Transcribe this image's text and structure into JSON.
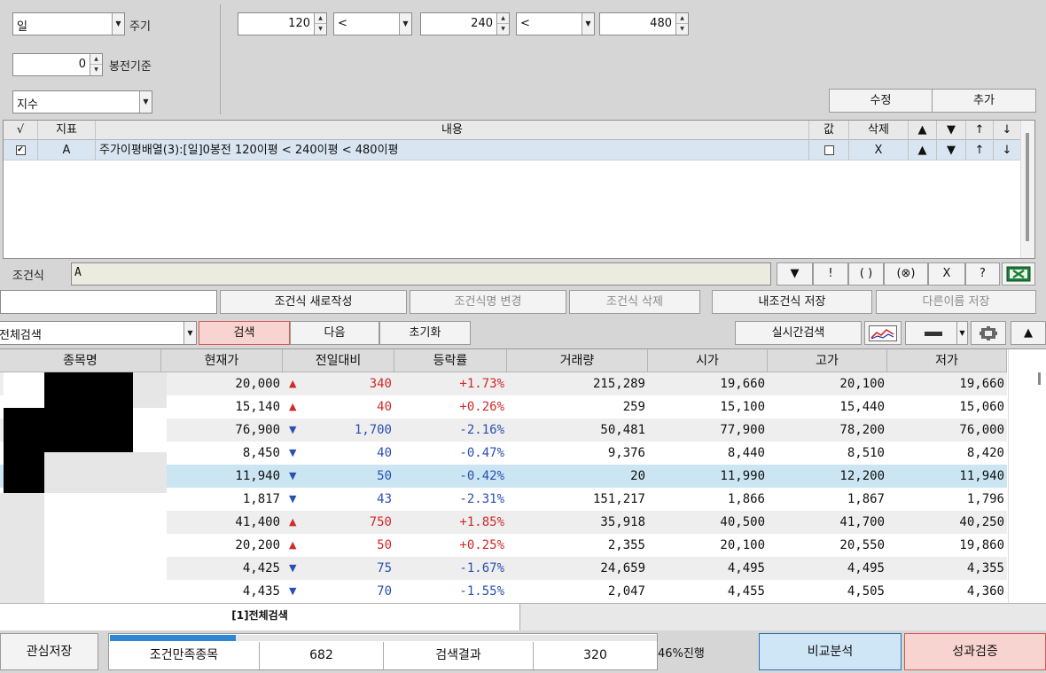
{
  "controls": {
    "period_value": "일",
    "period_label": "주기",
    "bar_value": "0",
    "bar_label": "봉전기준",
    "type_value": "지수",
    "ma1": "120",
    "op1": "<",
    "ma2": "240",
    "op2": "<",
    "ma3": "480",
    "modify_label": "수정",
    "add_label": "추가"
  },
  "condition_table": {
    "headers": [
      "√",
      "지표",
      "내용",
      "값",
      "삭제",
      "▲",
      "▼",
      "↑",
      "↓"
    ],
    "rows": [
      {
        "check": "✔",
        "indicator": "A",
        "content": "주가이평배열(3):[일]0봉전 120이평 < 240이평 < 480이평",
        "value": "",
        "delete": "X",
        "up": "▲",
        "down": "▼",
        "top": "↑",
        "bottom": "↓"
      }
    ]
  },
  "formula": {
    "label": "조건식",
    "value": "A",
    "ops": [
      "▼",
      "!",
      "( )",
      "(⊗)",
      "X",
      "?"
    ]
  },
  "actions": {
    "new": "조건식 새로작성",
    "rename": "조건식명 변경",
    "delete": "조건식 삭제",
    "save": "내조건식 저장",
    "save_as": "다른이름 저장"
  },
  "search": {
    "scope": "전체검색",
    "search": "검색",
    "next": "다음",
    "reset": "초기화",
    "realtime": "실시간검색",
    "up": "▲"
  },
  "grid": {
    "headers": [
      "종목명",
      "현재가",
      "전일대비",
      "등락률",
      "거래량",
      "시가",
      "고가",
      "저가"
    ],
    "rows": [
      {
        "price": "20,000",
        "dir": "up",
        "arrow": "▲",
        "change": "340",
        "rate": "+1.73%",
        "volume": "215,289",
        "open": "19,660",
        "high": "20,100",
        "low": "19,660"
      },
      {
        "price": "15,140",
        "dir": "up",
        "arrow": "▲",
        "change": "40",
        "rate": "+0.26%",
        "volume": "259",
        "open": "15,100",
        "high": "15,440",
        "low": "15,060"
      },
      {
        "price": "76,900",
        "dir": "dn",
        "arrow": "▼",
        "change": "1,700",
        "rate": "-2.16%",
        "volume": "50,481",
        "open": "77,900",
        "high": "78,200",
        "low": "76,000"
      },
      {
        "price": "8,450",
        "dir": "dn",
        "arrow": "▼",
        "change": "40",
        "rate": "-0.47%",
        "volume": "9,376",
        "open": "8,440",
        "high": "8,510",
        "low": "8,420"
      },
      {
        "price": "11,940",
        "dir": "dn",
        "arrow": "▼",
        "change": "50",
        "rate": "-0.42%",
        "volume": "20",
        "open": "11,990",
        "high": "12,200",
        "low": "11,940"
      },
      {
        "price": "1,817",
        "dir": "dn",
        "arrow": "▼",
        "change": "43",
        "rate": "-2.31%",
        "volume": "151,217",
        "open": "1,866",
        "high": "1,867",
        "low": "1,796"
      },
      {
        "price": "41,400",
        "dir": "up",
        "arrow": "▲",
        "change": "750",
        "rate": "+1.85%",
        "volume": "35,918",
        "open": "40,500",
        "high": "41,700",
        "low": "40,250"
      },
      {
        "price": "20,200",
        "dir": "up",
        "arrow": "▲",
        "change": "50",
        "rate": "+0.25%",
        "volume": "2,355",
        "open": "20,100",
        "high": "20,550",
        "low": "19,860"
      },
      {
        "price": "4,425",
        "dir": "dn",
        "arrow": "▼",
        "change": "75",
        "rate": "-1.67%",
        "volume": "24,659",
        "open": "4,495",
        "high": "4,495",
        "low": "4,355"
      },
      {
        "price": "4,435",
        "dir": "dn",
        "arrow": "▼",
        "change": "70",
        "rate": "-1.55%",
        "volume": "2,047",
        "open": "4,455",
        "high": "4,505",
        "low": "4,360"
      }
    ]
  },
  "tab": "[1]전체검색",
  "status": {
    "interest_save": "관심저장",
    "matched_label": "조건만족종목",
    "matched_count": "682",
    "result_label": "검색결과",
    "result_count": "320",
    "progress_text": "46%진행",
    "progress": 0.46,
    "compare": "비교분석",
    "verify": "성과검증"
  },
  "colors": {
    "up": "#cf2a2a",
    "down": "#2a4fb0",
    "selected_row": "#cbe6f2",
    "progress": "#2e86d4",
    "search_btn": "#f8d4d0",
    "compare_btn": "#cfe6f6"
  }
}
